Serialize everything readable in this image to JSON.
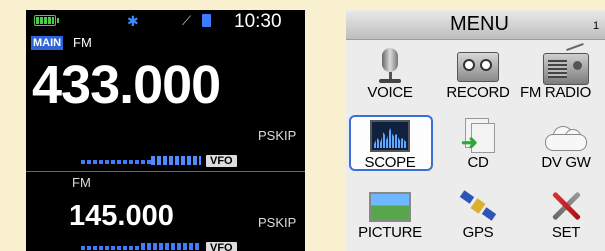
{
  "radio": {
    "time": "10:30",
    "main_badge": "MAIN",
    "main_mode": "FM",
    "main_frequency": "433.000",
    "main_pskip": "PSKIP",
    "main_vfo": "VFO",
    "sub_mode": "FM",
    "sub_frequency": "145.000",
    "sub_pskip": "PSKIP",
    "sub_vfo": "VFO",
    "colors": {
      "accent": "#2f63d8",
      "battery": "#4ccd4c",
      "meter": "#3f7cff"
    }
  },
  "menu": {
    "title": "MENU",
    "page": "1",
    "items": [
      {
        "label": "VOICE",
        "icon": "microphone-icon"
      },
      {
        "label": "RECORD",
        "icon": "recorder-icon"
      },
      {
        "label": "FM RADIO",
        "icon": "fm-radio-icon"
      },
      {
        "label": "SCOPE",
        "icon": "scope-icon",
        "selected": true
      },
      {
        "label": "CD",
        "icon": "copy-document-icon"
      },
      {
        "label": "DV GW",
        "icon": "cloud-icon"
      },
      {
        "label": "PICTURE",
        "icon": "picture-icon"
      },
      {
        "label": "GPS",
        "icon": "satellite-icon"
      },
      {
        "label": "SET",
        "icon": "tools-icon"
      }
    ],
    "colors": {
      "selection": "#3a6fd8"
    }
  }
}
